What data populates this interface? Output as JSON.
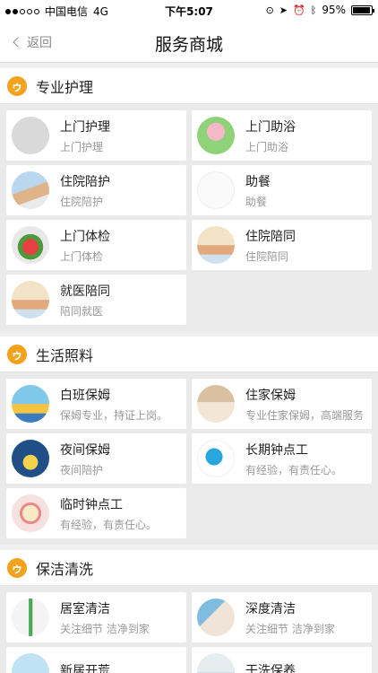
{
  "status_bar": {
    "carrier": "中国电信",
    "network": "4G",
    "time": "下午5:07",
    "battery": "95%",
    "battery_level": 0.95
  },
  "nav": {
    "back_label": "返回",
    "title": "服务商城"
  },
  "colors": {
    "accent": "#f2a21c"
  },
  "sections": [
    {
      "title": "专业护理",
      "logo": "ai-logo-icon",
      "items": [
        {
          "title": "上门护理",
          "subtitle": "上门护理",
          "icon": "placeholder-logo-thumb"
        },
        {
          "title": "上门助浴",
          "subtitle": "上门助浴",
          "icon": "bath-thumb"
        },
        {
          "title": "住院陪护",
          "subtitle": "住院陪护",
          "icon": "caregiver-thumb"
        },
        {
          "title": "助餐",
          "subtitle": "助餐",
          "icon": "cutlery-thumb"
        },
        {
          "title": "上门体检",
          "subtitle": "上门体检",
          "icon": "medical-cross-thumb"
        },
        {
          "title": "住院陪同",
          "subtitle": "住院陪同",
          "icon": "elderly-couple-thumb"
        },
        {
          "title": "就医陪同",
          "subtitle": "陪同就医",
          "icon": "elderly-couple-thumb"
        }
      ]
    },
    {
      "title": "生活照料",
      "logo": "ai-logo-icon",
      "items": [
        {
          "title": "白班保姆",
          "subtitle": "保姆专业，持证上岗。",
          "icon": "day-nanny-thumb"
        },
        {
          "title": "住家保姆",
          "subtitle": "专业住家保姆，高端服务",
          "icon": "live-in-nanny-thumb"
        },
        {
          "title": "夜间保姆",
          "subtitle": "夜间陪护",
          "icon": "night-nanny-thumb"
        },
        {
          "title": "长期钟点工",
          "subtitle": "有经验，有责任心。",
          "icon": "long-term-worker-thumb"
        },
        {
          "title": "临时钟点工",
          "subtitle": "有经验，有责任心。",
          "icon": "alarm-clock-thumb"
        }
      ]
    },
    {
      "title": "保洁清洗",
      "logo": "ai-logo-icon",
      "items": [
        {
          "title": "居室清洁",
          "subtitle": "关注细节 洁净到家",
          "icon": "mop-thumb"
        },
        {
          "title": "深度清洁",
          "subtitle": "关注细节 洁净到家",
          "icon": "deep-clean-thumb"
        },
        {
          "title": "新居开荒",
          "subtitle": "",
          "icon": "new-home-thumb"
        },
        {
          "title": "干洗保养",
          "subtitle": "",
          "icon": "dry-clean-thumb"
        }
      ]
    }
  ]
}
